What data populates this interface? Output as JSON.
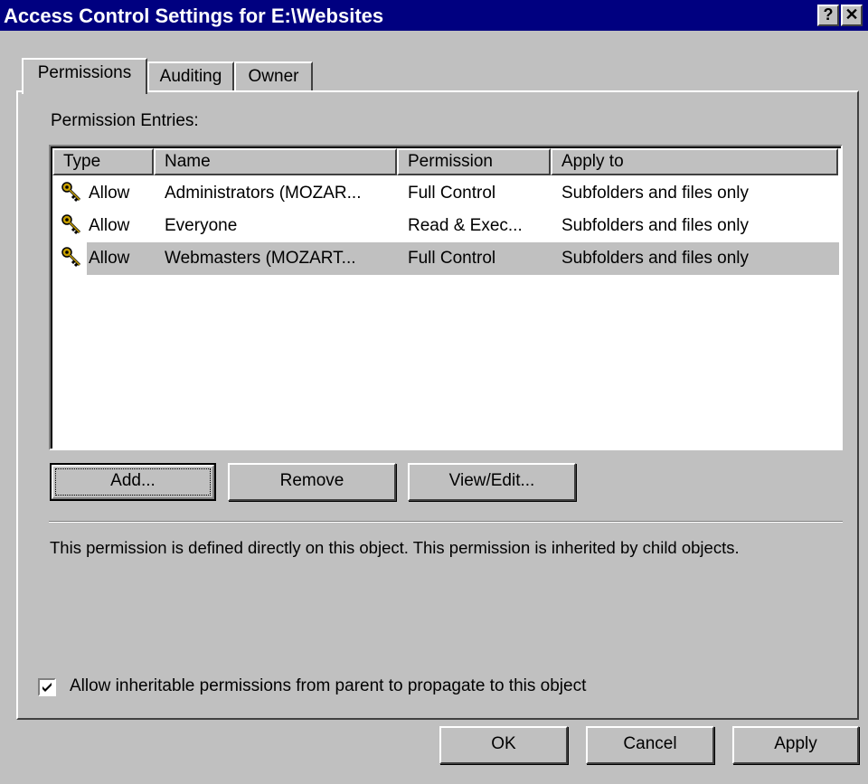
{
  "window": {
    "title": "Access Control Settings for E:\\Websites",
    "help_button": "?",
    "close_button": "✕"
  },
  "tabs": [
    {
      "label": "Permissions",
      "active": true
    },
    {
      "label": "Auditing",
      "active": false
    },
    {
      "label": "Owner",
      "active": false
    }
  ],
  "permissions": {
    "entries_label": "Permission Entries:",
    "columns": [
      "Type",
      "Name",
      "Permission",
      "Apply to"
    ],
    "rows": [
      {
        "type": "Allow",
        "name": "Administrators (MOZAR...",
        "permission": "Full Control",
        "apply_to": "Subfolders and files only",
        "icon": "key-icon"
      },
      {
        "type": "Allow",
        "name": "Everyone",
        "permission": "Read & Exec...",
        "apply_to": "Subfolders and files only",
        "icon": "key-icon"
      },
      {
        "type": "Allow",
        "name": "Webmasters (MOZART...",
        "permission": "Full Control",
        "apply_to": "Subfolders and files only",
        "icon": "key-icon",
        "selected": true
      }
    ],
    "buttons": {
      "add": "Add...",
      "remove": "Remove",
      "view_edit": "View/Edit..."
    },
    "description": "This permission is defined directly on this object.  This permission is inherited by child objects.",
    "inherit_checkbox": {
      "label": "Allow inheritable permissions from parent to propagate to this object",
      "checked": true
    }
  },
  "dialog_buttons": {
    "ok": "OK",
    "cancel": "Cancel",
    "apply": "Apply"
  }
}
